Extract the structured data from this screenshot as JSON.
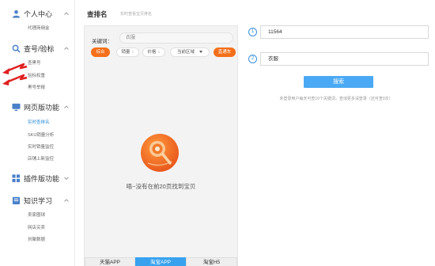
{
  "sidebar": {
    "groups": [
      {
        "title": "个人中心",
        "icon": "user-icon",
        "items": [
          {
            "label": "代理商佣金",
            "active": false
          }
        ]
      },
      {
        "title": "查号/验标",
        "icon": "search-icon",
        "items": [
          {
            "label": "查黑号",
            "active": false
          },
          {
            "label": "验标权重",
            "active": false
          },
          {
            "label": "黑号举报",
            "active": false
          }
        ]
      },
      {
        "title": "网页版功能",
        "icon": "monitor-icon",
        "items": [
          {
            "label": "实时查排名",
            "active": true
          },
          {
            "label": "SKU销量分析",
            "active": false
          },
          {
            "label": "实时销量监控",
            "active": false
          },
          {
            "label": "店铺上新监控",
            "active": false
          }
        ]
      },
      {
        "title": "插件版功能",
        "icon": "plugin-icon",
        "items": []
      },
      {
        "title": "知识学习",
        "icon": "book-icon",
        "items": [
          {
            "label": "卖家圈球",
            "active": false
          },
          {
            "label": "网店买卖",
            "active": false
          },
          {
            "label": "刘聚数据",
            "active": false
          }
        ]
      }
    ]
  },
  "header": {
    "title": "查排名",
    "subtitle": "实时查看宝贝排名"
  },
  "phone": {
    "keyword_label": "关键词：",
    "keyword_value": "衣服",
    "filters": [
      {
        "label": "综合",
        "style": "orange"
      },
      {
        "label": "销量",
        "style": "gray",
        "sort": "⇕"
      },
      {
        "label": "价格",
        "style": "gray",
        "sort": "⇕"
      },
      {
        "label": "当前区域",
        "style": "gray",
        "dropdown": true
      },
      {
        "label": "直通车",
        "style": "orange"
      }
    ],
    "empty_message": "唔~没有在前20页找到宝贝",
    "bottom_tabs": [
      {
        "label": "天猫APP",
        "active": false
      },
      {
        "label": "淘宝APP",
        "active": true
      },
      {
        "label": "淘宝H5",
        "active": false
      }
    ]
  },
  "form": {
    "step1": "1",
    "item_id": "11564",
    "step2": "2",
    "keyword": "衣服",
    "search_label": "搜索",
    "notice": "未登录用户每天可查10个关键词，查询更多请登录（还可查0次）"
  },
  "colors": {
    "accent_blue": "#4aa9f4",
    "accent_orange": "#f56f1a",
    "active_link": "#2a8bd6"
  }
}
